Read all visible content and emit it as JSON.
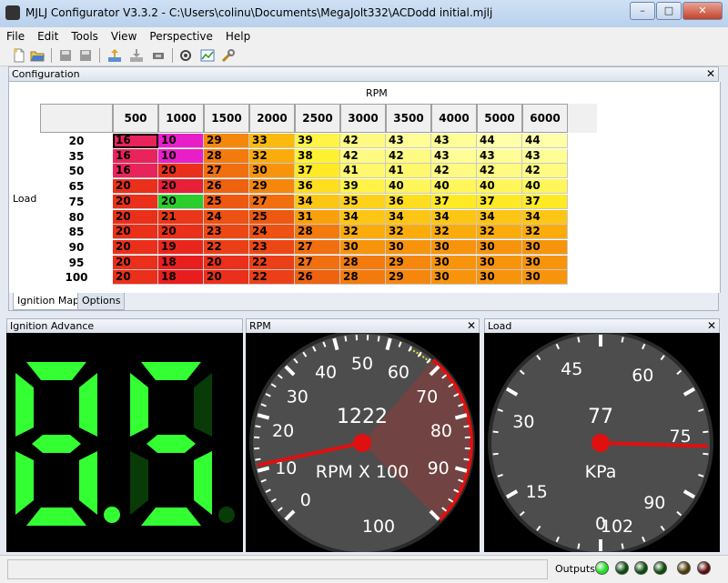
{
  "window": {
    "title": "MJLJ Configurator V3.3.2 - C:\\Users\\colinu\\Documents\\MegaJolt332\\ACDodd initial.mjlj"
  },
  "menu": [
    "File",
    "Edit",
    "Tools",
    "View",
    "Perspective",
    "Help"
  ],
  "config": {
    "header": "Configuration",
    "rpm_label": "RPM",
    "load_label": "Load",
    "rpm_bins": [
      "500",
      "1000",
      "1500",
      "2000",
      "2500",
      "3000",
      "3500",
      "4000",
      "5000",
      "6000"
    ],
    "load_bins": [
      "20",
      "35",
      "50",
      "65",
      "75",
      "80",
      "85",
      "90",
      "95",
      "100"
    ],
    "table": [
      [
        "16",
        "10",
        "29",
        "33",
        "39",
        "42",
        "43",
        "43",
        "44",
        "44"
      ],
      [
        "16",
        "10",
        "28",
        "32",
        "38",
        "42",
        "42",
        "43",
        "43",
        "43"
      ],
      [
        "16",
        "20",
        "27",
        "30",
        "37",
        "41",
        "41",
        "42",
        "42",
        "42"
      ],
      [
        "20",
        "20",
        "26",
        "29",
        "36",
        "39",
        "40",
        "40",
        "40",
        "40"
      ],
      [
        "20",
        "20",
        "25",
        "27",
        "34",
        "35",
        "36",
        "37",
        "37",
        "37"
      ],
      [
        "20",
        "21",
        "24",
        "25",
        "31",
        "34",
        "34",
        "34",
        "34",
        "34"
      ],
      [
        "20",
        "20",
        "23",
        "24",
        "28",
        "32",
        "32",
        "32",
        "32",
        "32"
      ],
      [
        "20",
        "19",
        "22",
        "23",
        "27",
        "30",
        "30",
        "30",
        "30",
        "30"
      ],
      [
        "20",
        "18",
        "20",
        "22",
        "27",
        "28",
        "29",
        "30",
        "30",
        "30"
      ],
      [
        "20",
        "18",
        "20",
        "22",
        "26",
        "28",
        "29",
        "30",
        "30",
        "30"
      ]
    ],
    "selected_cell": {
      "row": 0,
      "col": 0
    },
    "special_cells": {
      "0-1": "#e81fc8",
      "1-1": "#e81fc8",
      "0-0": "#e8245a",
      "1-0": "#e8245a",
      "2-0": "#e8245a",
      "3-1": "#e81f38",
      "4-1": "#2ccc2c"
    },
    "tabs": [
      "Ignition Map",
      "Options"
    ],
    "active_tab": 0
  },
  "ignition": {
    "header": "Ignition Advance",
    "value": "8.5",
    "digit_on_color": "#33ff33",
    "digit_off_color": "#083b08"
  },
  "rpm_gauge": {
    "header": "RPM",
    "value": 1222,
    "unit": "RPM X 100",
    "scale_labels": [
      "0",
      "10",
      "20",
      "30",
      "40",
      "50",
      "60",
      "70",
      "80",
      "90",
      "100"
    ],
    "needle_value": 12.22
  },
  "load_gauge": {
    "header": "Load",
    "value": 77,
    "unit": "KPa",
    "scale_labels": [
      "0",
      "15",
      "30",
      "45",
      "60",
      "75",
      "90",
      "102"
    ],
    "needle_value": 77
  },
  "status": {
    "outputs_label": "Outputs",
    "leds": [
      "#22dd22",
      "#0a4a0a",
      "#0a4a0a",
      "#0a4a0a",
      "#4a3a05",
      "#5a0a0a"
    ]
  },
  "icons": [
    "new-file-icon",
    "open-folder-icon",
    "save-icon",
    "save-as-icon",
    "export-icon",
    "import-icon",
    "write-icon",
    "settings-icon",
    "chart-icon",
    "tools-icon"
  ]
}
